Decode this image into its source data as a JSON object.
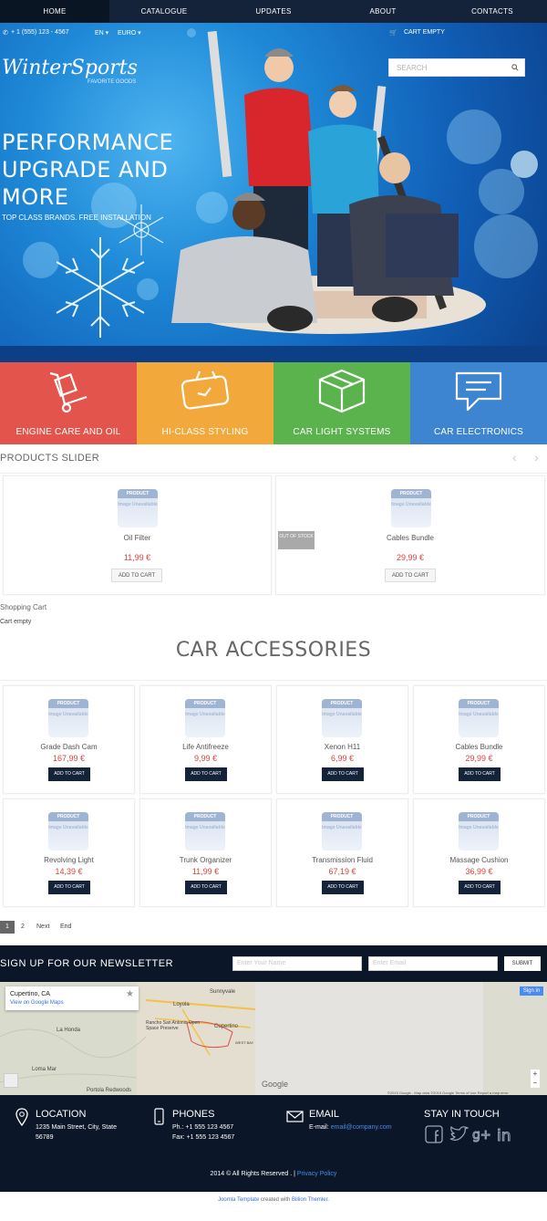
{
  "nav": {
    "items": [
      "HOME",
      "CATALOGUE",
      "UPDATES",
      "ABOUT",
      "CONTACTS"
    ],
    "active_index": 0
  },
  "infobar": {
    "phone": "+ 1 (555) 123 - 4567",
    "language": "EN",
    "currency": "EURO",
    "cart": "CART EMPTY"
  },
  "hero": {
    "logo": "WinterSports",
    "logo_tagline": "FAVORITE GOODS",
    "search_placeholder": "SEARCH",
    "title_lines": [
      "PERFORMANCE",
      "UPGRADE AND",
      "MORE"
    ],
    "subtitle": "TOP CLASS BRANDS. FREE INSTALLATION"
  },
  "tiles": [
    {
      "label": "ENGINE CARE AND OIL",
      "color": "#e2544c",
      "icon": "hand-truck-icon"
    },
    {
      "label": "HI-CLASS STYLING",
      "color": "#f3a83b",
      "icon": "clock-card-icon"
    },
    {
      "label": "CAR LIGHT SYSTEMS",
      "color": "#5bb34e",
      "icon": "box-icon"
    },
    {
      "label": "CAR ELECTRONICS",
      "color": "#3d85d0",
      "icon": "speech-bubble-icon"
    }
  ],
  "slider": {
    "heading": "PRODUCTS SLIDER",
    "image_placeholder_top": "PRODUCT",
    "image_placeholder_bottom": "Image Unavailable",
    "out_of_stock": "OUT OF STOCK",
    "products": [
      {
        "name": "Oil Filter",
        "price": "11,99 €",
        "button": "ADD TO CART"
      },
      {
        "name": "Cables Bundle",
        "price": "29,99 €",
        "button": "ADD TO CART"
      }
    ]
  },
  "cart": {
    "title": "Shopping Cart",
    "status": "Cart empty"
  },
  "accessories": {
    "heading": "CAR ACCESSORIES",
    "products": [
      {
        "name": "Grade Dash Cam",
        "price": "167,99 €",
        "button": "ADD TO CART"
      },
      {
        "name": "Life Antifreeze",
        "price": "9,99 €",
        "button": "ADD TO CART"
      },
      {
        "name": "Xenon H11",
        "price": "6,99 €",
        "button": "ADD TO CART"
      },
      {
        "name": "Cables Bundle",
        "price": "29,99 €",
        "button": "ADD TO CART"
      },
      {
        "name": "Revolving Light",
        "price": "14,39 €",
        "button": "ADD TO CART"
      },
      {
        "name": "Trunk Organizer",
        "price": "11,99 €",
        "button": "ADD TO CART"
      },
      {
        "name": "Transmission Fluid",
        "price": "67,19 €",
        "button": "ADD TO CART"
      },
      {
        "name": "Massage Cushion",
        "price": "36,99 €",
        "button": "ADD TO CART"
      }
    ]
  },
  "pagination": {
    "current": "1",
    "page2": "2",
    "next": "Next",
    "end": "End"
  },
  "newsletter": {
    "title": "SIGN UP FOR OUR NEWSLETTER",
    "name_placeholder": "Enter Your Name",
    "email_placeholder": "Enter Email",
    "submit": "SUBMIT"
  },
  "map": {
    "place": "Cupertino, CA",
    "link": "View on Google Maps",
    "sign_in": "Sign in",
    "google": "Google",
    "labels": [
      "Sunnyvale",
      "Loyola",
      "Cupertino",
      "Rancho San Antonio Open Space Preserve",
      "La Honda",
      "Loma Mar",
      "Portola Redwoods",
      "WEST BAY"
    ],
    "footer_text": "©2015 Google - Map data ©2015 Google    Terms of Use    Report a map error"
  },
  "footer": {
    "location": {
      "heading": "LOCATION",
      "line1": "1235 Main Street, City, State",
      "line2": "56789"
    },
    "phones": {
      "heading": "PHONES",
      "line1": "Ph.: +1 555 123 4567",
      "line2": "Fax: +1 555 123 4567"
    },
    "email": {
      "heading": "EMAIL",
      "label": "E-mail: ",
      "address": "email@company.com"
    },
    "social": {
      "heading": "STAY IN TOUCH",
      "icons": [
        "facebook-icon",
        "twitter-icon",
        "google-plus-icon",
        "linkedin-icon"
      ]
    },
    "copyright": "2014 © All Rights Reserved . |",
    "privacy": "Privacy Policy",
    "credit_link1": "Joomla Template",
    "credit_mid": " created with ",
    "credit_link2": "Billion Themler."
  }
}
